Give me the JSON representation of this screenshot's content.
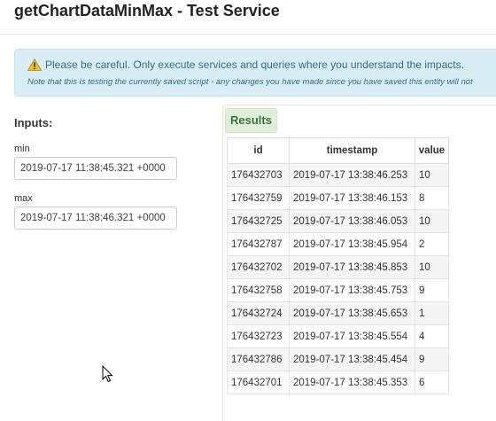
{
  "page": {
    "title": "getChartDataMinMax - Test Service"
  },
  "alert": {
    "warning": "Please be careful. Only execute services and queries where you understand the impacts.",
    "note": "Note that this is testing the currently saved script - any changes you have made since you have saved this entity will not"
  },
  "inputs": {
    "heading": "Inputs:",
    "min_label": "min",
    "min_value": "2019-07-17 11:38:45.321 +0000",
    "max_label": "max",
    "max_value": "2019-07-17 11:38:46.321 +0000"
  },
  "results": {
    "tab_label": "Results",
    "columns": [
      "id",
      "timestamp",
      "value"
    ],
    "rows": [
      [
        "176432703",
        "2019-07-17 13:38:46.253",
        "10"
      ],
      [
        "176432759",
        "2019-07-17 13:38:46.153",
        "8"
      ],
      [
        "176432725",
        "2019-07-17 13:38:46.053",
        "10"
      ],
      [
        "176432787",
        "2019-07-17 13:38:45.954",
        "2"
      ],
      [
        "176432702",
        "2019-07-17 13:38:45.853",
        "10"
      ],
      [
        "176432758",
        "2019-07-17 13:38:45.753",
        "9"
      ],
      [
        "176432724",
        "2019-07-17 13:38:45.653",
        "1"
      ],
      [
        "176432723",
        "2019-07-17 13:38:45.554",
        "4"
      ],
      [
        "176432786",
        "2019-07-17 13:38:45.454",
        "9"
      ],
      [
        "176432701",
        "2019-07-17 13:38:45.353",
        "6"
      ]
    ]
  },
  "icons": {
    "warning": "warning-triangle-icon",
    "cursor": "mouse-pointer-icon"
  },
  "colors": {
    "alert_bg": "#d9edf7",
    "alert_text": "#31708f",
    "results_tab_bg": "#dff0d8",
    "results_tab_text": "#3c763d",
    "warning_yellow": "#f0c020"
  }
}
